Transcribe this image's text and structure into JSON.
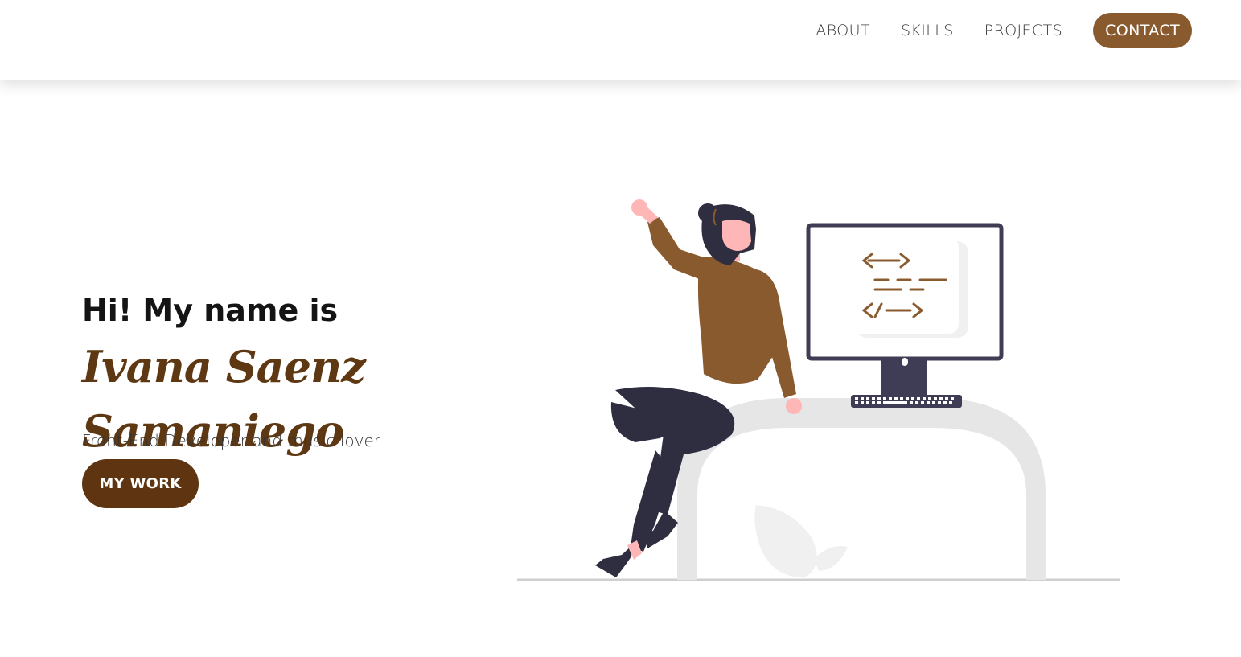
{
  "nav": {
    "items": [
      "ABOUT",
      "SKILLS",
      "PROJECTS"
    ],
    "contact_label": "CONTACT"
  },
  "hero": {
    "greeting": "Hi! My name is",
    "name": "Ivana Saenz Samaniego",
    "tagline": "Front-End Developer and music lover",
    "cta_label": "MY WORK"
  },
  "illustration": {
    "screen_lines": [
      "<—>",
      "— — —",
      "</—>"
    ]
  },
  "colors": {
    "accent": "#8a5a2f",
    "button_dark": "#5e3510",
    "name_color": "#5e3812",
    "monitor": "#3f3d56",
    "desk": "#e6e6e6"
  }
}
